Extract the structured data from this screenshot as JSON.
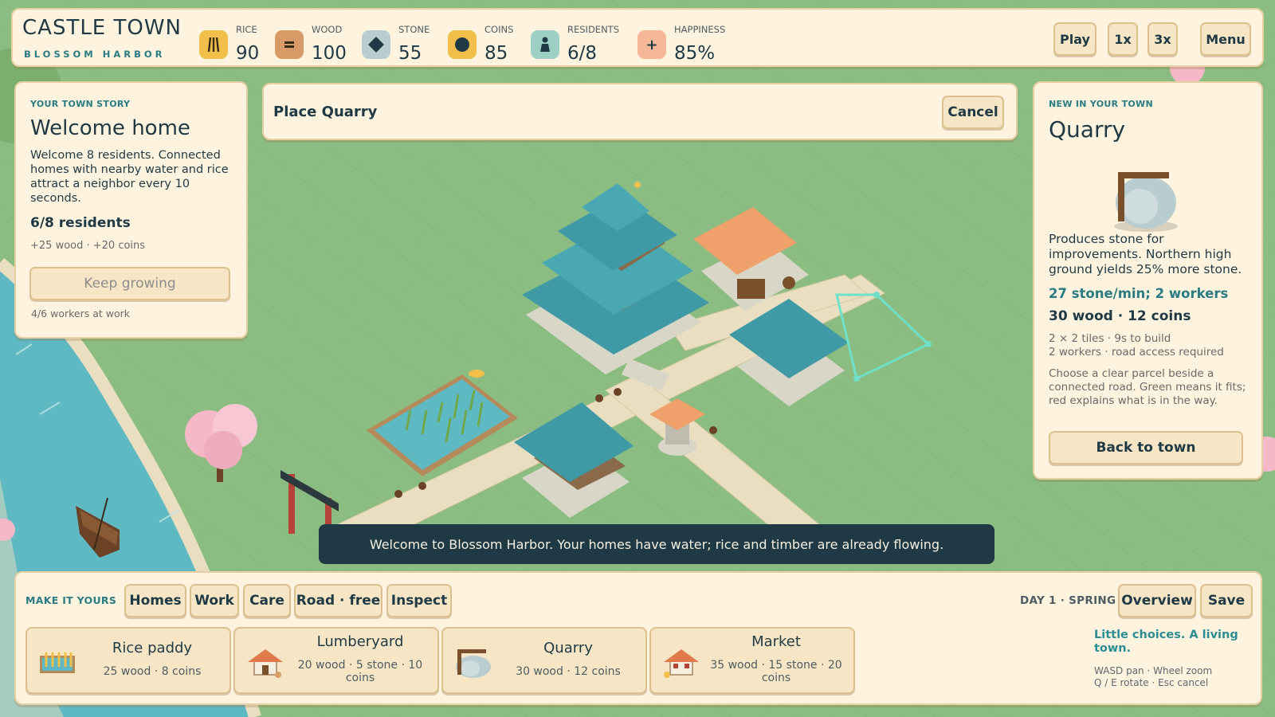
{
  "town": {
    "title": "CASTLE TOWN",
    "subtitle": "BLOSSOM HARBOR"
  },
  "resources": [
    {
      "label": "RICE",
      "value": "90",
      "icon": "rice-icon",
      "color": "#f2c04a"
    },
    {
      "label": "WOOD",
      "value": "100",
      "icon": "wood-icon",
      "color": "#d89a66"
    },
    {
      "label": "STONE",
      "value": "55",
      "icon": "stone-icon",
      "color": "#b9cdd0"
    },
    {
      "label": "COINS",
      "value": "85",
      "icon": "coin-icon",
      "color": "#f2c04a"
    },
    {
      "label": "RESIDENTS",
      "value": "6/8",
      "icon": "resident-icon",
      "color": "#9dcfc4"
    },
    {
      "label": "HAPPINESS",
      "value": "85%",
      "icon": "happiness-icon",
      "color": "#f7b899"
    }
  ],
  "top_controls": {
    "play": "Play",
    "speed_1x": "1x",
    "speed_3x": "3x",
    "menu": "Menu"
  },
  "story": {
    "kicker": "YOUR TOWN STORY",
    "title": "Welcome home",
    "body": "Welcome 8 residents. Connected homes with nearby water and rice attract a neighbor every 10 seconds.",
    "residents": "6/8 residents",
    "reward": "+25 wood · +20 coins",
    "button": "Keep growing",
    "workers": "4/6 workers at work"
  },
  "placement": {
    "label": "Place Quarry",
    "cancel": "Cancel"
  },
  "info": {
    "kicker": "NEW IN YOUR TOWN",
    "title": "Quarry",
    "description": "Produces stone for improvements. Northern high ground yields 25% more stone.",
    "rate": "27 stone/min; 2 workers",
    "cost": "30 wood · 12 coins",
    "meta_1": "2 × 2 tiles · 9s to build",
    "meta_2": "2 workers · road access required",
    "hint": "Choose a clear parcel beside a connected road. Green means it fits; red explains what is in the way.",
    "button": "Back to town"
  },
  "toast": "Welcome to Blossom Harbor. Your homes have water; rice and timber are already flowing.",
  "bottom": {
    "make_label": "MAKE IT YOURS",
    "tabs": [
      "Homes",
      "Work",
      "Care",
      "Road · free",
      "Inspect"
    ],
    "day": "DAY 1 · SPRING",
    "overview": "Overview",
    "save": "Save",
    "tagline": "Little choices. A living town.",
    "controls_1": "WASD pan · Wheel zoom",
    "controls_2": "Q / E rotate · Esc cancel",
    "cards": [
      {
        "name": "Rice paddy",
        "cost": "25 wood · 8 coins",
        "icon": "rice-paddy-icon"
      },
      {
        "name": "Lumberyard",
        "cost": "20 wood · 5 stone · 10 coins",
        "icon": "lumberyard-icon"
      },
      {
        "name": "Quarry",
        "cost": "30 wood · 12 coins",
        "icon": "quarry-icon"
      },
      {
        "name": "Market",
        "cost": "35 wood · 15 stone · 20 coins",
        "icon": "market-icon"
      }
    ]
  },
  "colors": {
    "panel_bg": "#fdf3de",
    "accent_teal": "#2b7c82",
    "grass": "#8bbd82",
    "water": "#5fb9c2",
    "roof_teal": "#3f9aa6",
    "roof_orange": "#f0a06a",
    "blossom": "#f7c0cc",
    "toast_bg": "#1f3a45"
  }
}
